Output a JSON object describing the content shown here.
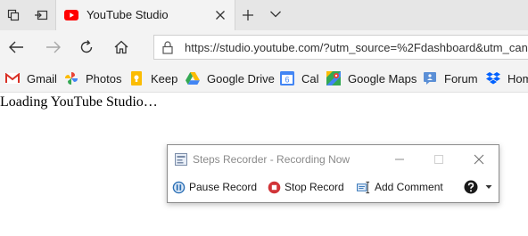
{
  "tab": {
    "title": "YouTube Studio"
  },
  "address_bar": {
    "url": "https://studio.youtube.com/?utm_source=%2Fdashboard&utm_can"
  },
  "favorites": [
    {
      "label": "Gmail",
      "icon": "gmail-icon"
    },
    {
      "label": "Photos",
      "icon": "photos-icon"
    },
    {
      "label": "Keep",
      "icon": "keep-icon"
    },
    {
      "label": "Google Drive",
      "icon": "drive-icon"
    },
    {
      "label": "Cal",
      "icon": "calendar-icon",
      "icon_text": "6"
    },
    {
      "label": "Google Maps",
      "icon": "maps-icon"
    },
    {
      "label": "Forum",
      "icon": "forum-icon"
    },
    {
      "label": "Hom",
      "icon": "dropbox-icon"
    }
  ],
  "page": {
    "loading_text": "Loading YouTube Studio…"
  },
  "steps_recorder": {
    "title": "Steps Recorder - Recording Now",
    "pause_label": "Pause Record",
    "stop_label": "Stop Record",
    "add_comment_label": "Add Comment"
  },
  "colors": {
    "youtube_red": "#ff0000",
    "record_red": "#d13438",
    "pause_blue": "#2a6fb5"
  }
}
